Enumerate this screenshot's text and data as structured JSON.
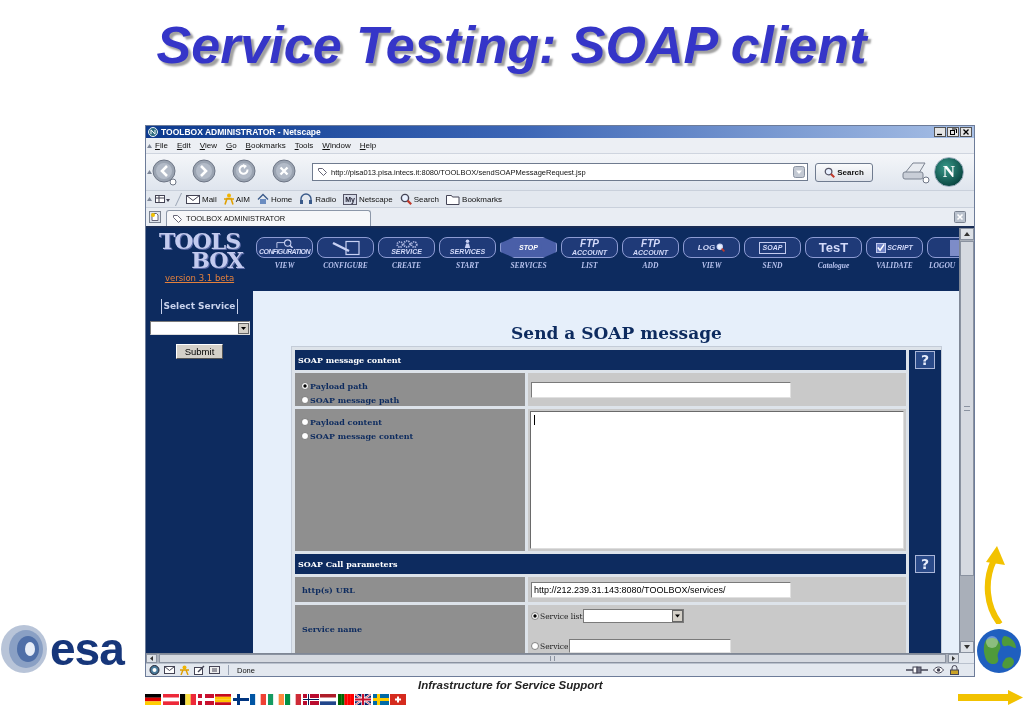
{
  "slide": {
    "title": "Service Testing: SOAP client",
    "logo_text": "esa",
    "footer_text": "Infrastructure for Service Support"
  },
  "window": {
    "title": "TOOLBOX ADMINISTRATOR - Netscape"
  },
  "menu_bar": [
    "File",
    "Edit",
    "View",
    "Go",
    "Bookmarks",
    "Tools",
    "Window",
    "Help"
  ],
  "navigation_bar": {
    "url": "http://pisa013.pisa.intecs.it:8080/TOOLBOX/sendSOAPMessageRequest.jsp",
    "search_button": "Search",
    "brand_mark": "N"
  },
  "personal_toolbar": [
    {
      "kind": "mail",
      "label": "Mail"
    },
    {
      "kind": "person",
      "label": "AIM"
    },
    {
      "kind": "home",
      "label": "Home"
    },
    {
      "kind": "headphones",
      "label": "Radio"
    },
    {
      "kind": "badge",
      "badge": "My",
      "label": "Netscape"
    },
    {
      "kind": "search",
      "label": "Search"
    },
    {
      "kind": "folder",
      "label": "Bookmarks"
    }
  ],
  "tab": {
    "label": "TOOLBOX ADMINISTRATOR"
  },
  "toolbox": {
    "logo": [
      "TOOLS",
      "BOX"
    ],
    "version_link": "version 3.1 beta",
    "tools": [
      {
        "kind": "magnifier",
        "art": [
          "CONFIGURATION"
        ],
        "label": "VIEW"
      },
      {
        "kind": "pencil",
        "label": "CONFIGURE"
      },
      {
        "kind": "gears",
        "art": [
          "SERVICE"
        ],
        "label": "CREATE"
      },
      {
        "kind": "wizard",
        "art": [
          "SERVICES"
        ],
        "label": "START"
      },
      {
        "kind": "stop",
        "art": [
          "STOP"
        ],
        "label": "SERVICES"
      },
      {
        "kind": "plain",
        "art": [
          "FTP",
          "ACCOUNT"
        ],
        "label": "LIST"
      },
      {
        "kind": "plain",
        "art": [
          "FTP",
          "ACCOUNT"
        ],
        "label": "ADD"
      },
      {
        "kind": "log",
        "art": [
          "LOG"
        ],
        "label": "VIEW"
      },
      {
        "kind": "envelope",
        "art": [
          "SOAP"
        ],
        "label": "SEND"
      },
      {
        "kind": "plain",
        "art": [
          "TesT"
        ],
        "label": "Catalogue"
      },
      {
        "kind": "check",
        "art": [
          "SCRIPT"
        ],
        "label": "VALIDATE"
      },
      {
        "kind": "door",
        "label": "LOGOU"
      }
    ]
  },
  "sidebar": {
    "heading": "Select Service",
    "submit_button": "Submit"
  },
  "form": {
    "heading": "Send a SOAP message",
    "sections": [
      {
        "title": "SOAP message content",
        "help": "?",
        "rows": [
          {
            "kind": "radio_field",
            "options": [
              {
                "label": "Payload path",
                "selected": true
              },
              {
                "label": "SOAP message path",
                "selected": false
              }
            ]
          },
          {
            "kind": "radio_textarea",
            "focused": true,
            "options": [
              {
                "label": "Payload content",
                "selected": false
              },
              {
                "label": "SOAP message content",
                "selected": false
              }
            ]
          }
        ]
      },
      {
        "title": "SOAP Call parameters",
        "help": "?",
        "rows": [
          {
            "kind": "text_field",
            "label": "http(s) URL",
            "value": "http://212.239.31.143:8080/TOOLBOX/services/"
          },
          {
            "kind": "choice",
            "label": "Service name",
            "options": [
              {
                "label": "Service list",
                "selected": true,
                "kind": "select"
              },
              {
                "label": "Service",
                "selected": false,
                "kind": "input"
              }
            ]
          }
        ]
      }
    ]
  },
  "status_bar": {
    "text": "Done"
  }
}
